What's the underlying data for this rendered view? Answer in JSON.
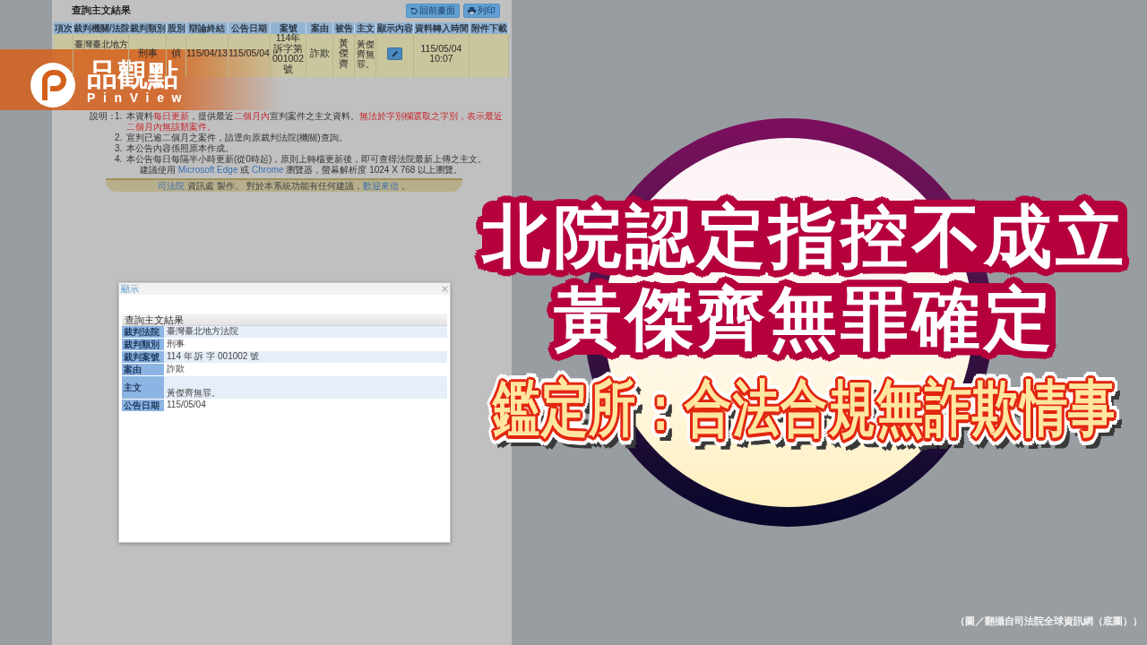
{
  "logo": {
    "name": "品觀點",
    "latin_name": "PinView"
  },
  "court_page": {
    "title": "查詢主文結果",
    "buttons": [
      {
        "kind": "back",
        "label": "回前畫面"
      },
      {
        "kind": "print",
        "label": "列印"
      }
    ],
    "table": {
      "columns": [
        "項次",
        "裁判機關/法院",
        "裁判類別",
        "股別",
        "辯論終結",
        "公告日期",
        "案號",
        "案由",
        "被告",
        "主文",
        "顯示內容",
        "資料轉入時間",
        "附件下載"
      ],
      "rows": [
        {
          "cells": [
            {
              "kind": "blank"
            },
            {
              "kind": "partial_text",
              "text": "臺灣臺北地方"
            },
            {
              "kind": "text",
              "text": "刑事"
            },
            {
              "kind": "text",
              "text": "偵"
            },
            {
              "kind": "text",
              "text": "115/04/13"
            },
            {
              "kind": "text",
              "text": "115/05/04"
            },
            {
              "kind": "text",
              "text": "114年訴字第001002號"
            },
            {
              "kind": "text",
              "text": "詐欺"
            },
            {
              "kind": "text",
              "text": "黃傑齊"
            },
            {
              "kind": "small_text",
              "text": "黃傑齊無罪。"
            },
            {
              "kind": "edit_button"
            },
            {
              "kind": "text",
              "text": "115/05/04 10:07"
            },
            {
              "kind": "blank"
            }
          ]
        }
      ]
    },
    "notes": {
      "label": "說明：",
      "items": [
        {
          "number": "1.",
          "segments": [
            {
              "kind": "plain",
              "text": "本資料"
            },
            {
              "kind": "highlight",
              "text": "每日更新"
            },
            {
              "kind": "plain",
              "text": "，提供最近"
            },
            {
              "kind": "highlight",
              "text": "二個月內"
            },
            {
              "kind": "plain",
              "text": "宣判案件之主文資料。"
            },
            {
              "kind": "highlight",
              "text": "無法於字別欄選取之字別，表示最近二個月內無該類案件。"
            }
          ]
        },
        {
          "number": "2.",
          "segments": [
            {
              "kind": "plain",
              "text": "宣判已逾二個月之案件，請逕向原裁判法院(機關)查詢。"
            }
          ]
        },
        {
          "number": "3.",
          "segments": [
            {
              "kind": "plain",
              "text": "本公告內容係照原本作成。"
            }
          ]
        },
        {
          "number": "4.",
          "segments": [
            {
              "kind": "plain",
              "text": "本公告每日每隔半小時更新(從0時起)，原則上轉檔更新後，即可查得法院最新上傳之主文。"
            }
          ]
        },
        {
          "segments": [
            {
              "kind": "plain",
              "text": "建議使用 "
            },
            {
              "kind": "link",
              "text": "Microsoft Edge"
            },
            {
              "kind": "plain",
              "text": " 或 "
            },
            {
              "kind": "link",
              "text": "Chrome"
            },
            {
              "kind": "plain",
              "text": " 瀏覽器，螢幕解析度 1024 X 768 以上瀏覽。"
            }
          ]
        }
      ]
    },
    "footer": {
      "segments": [
        {
          "kind": "link",
          "text": "司法院"
        },
        {
          "kind": "plain",
          "text": " 資訊處 製作。 對於本系統功能有任何建議，"
        },
        {
          "kind": "link",
          "text": "歡迎來信"
        },
        {
          "kind": "plain",
          "text": " 。"
        }
      ]
    }
  },
  "dialog": {
    "title": "顯示",
    "table_title": "查詢主文結果",
    "rows": [
      {
        "kind": "field",
        "label": "裁判法院",
        "value": "臺灣臺北地方法院"
      },
      {
        "kind": "field",
        "label": "裁判類別",
        "value": "刑事"
      },
      {
        "kind": "field",
        "label": "裁判案號",
        "value": "114 年 訴 字 001002 號"
      },
      {
        "kind": "field",
        "label": "案由",
        "value": "詐欺"
      },
      {
        "kind": "main_text",
        "label": "主文",
        "value": "黃傑齊無罪。"
      },
      {
        "kind": "field",
        "label": "公告日期",
        "value": "115/05/04"
      }
    ]
  },
  "headline": {
    "lines": [
      {
        "kind": "main",
        "text": "北院認定指控不成立"
      },
      {
        "kind": "main",
        "text": "黃傑齊無罪確定"
      },
      {
        "kind": "sub",
        "text": "鑑定所：合法合規無詐欺情事"
      }
    ]
  },
  "caption": "（圖／翻攝自司法院全球資訊網（底圖））"
}
